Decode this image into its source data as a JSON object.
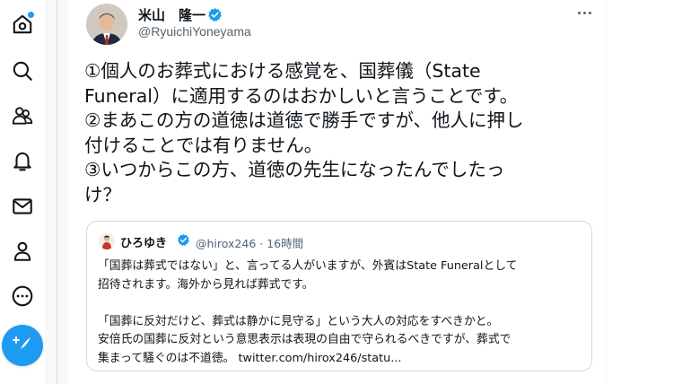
{
  "sidebar": {
    "items": [
      {
        "name": "home",
        "icon": "home-icon"
      },
      {
        "name": "explore",
        "icon": "search-icon"
      },
      {
        "name": "communities",
        "icon": "communities-icon"
      },
      {
        "name": "notifications",
        "icon": "bell-icon"
      },
      {
        "name": "messages",
        "icon": "envelope-icon"
      },
      {
        "name": "profile",
        "icon": "person-icon"
      },
      {
        "name": "more",
        "icon": "more-circle-icon"
      }
    ],
    "compose_icon": "feather-plus-icon",
    "accent_color": "#1d9bf0"
  },
  "tweet": {
    "display_name": "米山　隆一",
    "handle": "@RyuichiYoneyama",
    "verified": true,
    "lines": [
      "①個人のお葬式における感覚を、国葬儀（State",
      "Funeral）に適用するのはおかしいと言うことです。",
      "②まあこの方の道徳は道徳で勝手ですが、他人に押し",
      "付けることでは有りません。",
      "③いつからこの方、道徳の先生になったんでしたっ",
      "け？"
    ]
  },
  "quote": {
    "display_name": "ひろゆき",
    "verified": true,
    "handle_time": "@hirox246 · 16時間",
    "paragraph1": [
      "「国葬は葬式ではない」と、言ってる人がいますが、外賓はState Funeralとして",
      "招待されます。海外から見れば葬式です。"
    ],
    "paragraph2": [
      "「国葬に反対だけど、葬式は静かに見守る」という大人の対応をすべきかと。",
      "安倍氏の国葬に反対という意思表示は表現の自由で守られるべきですが、葬式で",
      "集まって騒ぐのは不道徳。 twitter.com/hirox246/statu..."
    ]
  }
}
